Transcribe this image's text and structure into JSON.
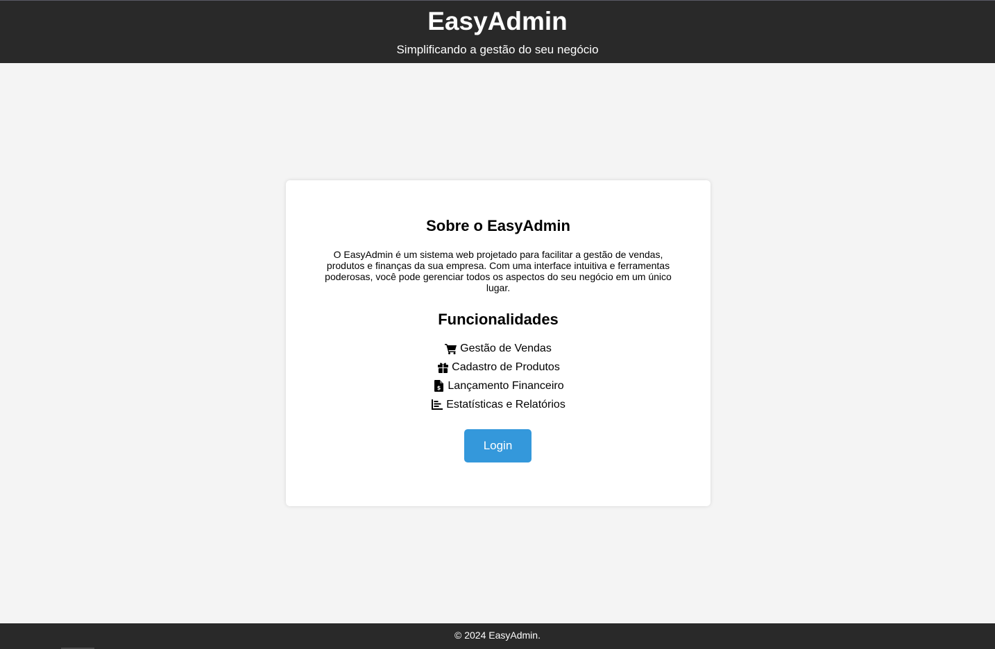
{
  "header": {
    "title": "EasyAdmin",
    "subtitle": "Simplificando a gestão do seu negócio"
  },
  "about": {
    "title": "Sobre o EasyAdmin",
    "text": "O EasyAdmin é um sistema web projetado para facilitar a gestão de vendas, produtos e finanças da sua empresa. Com uma interface intuitiva e ferramentas poderosas, você pode gerenciar todos os aspectos do seu negócio em um único lugar."
  },
  "features": {
    "title": "Funcionalidades",
    "items": [
      {
        "icon": "shopping-cart-icon",
        "label": "Gestão de Vendas"
      },
      {
        "icon": "gift-box-icon",
        "label": "Cadastro de Produtos"
      },
      {
        "icon": "invoice-dollar-icon",
        "label": "Lançamento Financeiro"
      },
      {
        "icon": "bar-chart-icon",
        "label": "Estatísticas e Relatórios"
      }
    ]
  },
  "login": {
    "label": "Login"
  },
  "footer": {
    "text": "© 2024 EasyAdmin."
  },
  "colors": {
    "header_bg": "#292929",
    "page_bg": "#f4f4f4",
    "card_bg": "#ffffff",
    "accent": "#3498db"
  }
}
